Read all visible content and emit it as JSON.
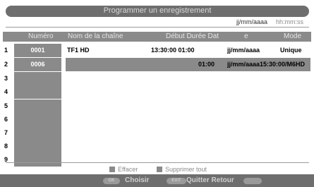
{
  "title": "Programmer un enregistrement",
  "hints": {
    "date_format": "jj/mm/aaaa",
    "time_format": "hh:mm:ss"
  },
  "table": {
    "headers": {
      "numero": "Numéro",
      "chaine": "Nom de la chaîne",
      "debut": "Début Durée Dat",
      "e": "e",
      "mode": "Mode"
    },
    "row_indices": [
      "1",
      "2",
      "3",
      "4",
      "5",
      "6",
      "7",
      "8",
      "9"
    ],
    "rows": [
      {
        "numero": "0001",
        "chaine": "TF1 HD",
        "debut": "13:30:00 01:00",
        "date": "jj/mm/aaaa",
        "mode": "Unique"
      },
      {
        "numero": "0006",
        "chaine": "",
        "debut": "01:00",
        "date": "jj/mm/aaaa15:30:00/M6HD",
        "mode": ""
      }
    ]
  },
  "legend": {
    "effacer": "Effacer",
    "supprimer_tout": "Supprimer tout"
  },
  "bottom": {
    "ok_key": "OK",
    "choisir": "Choisir",
    "exit_key": "EXIT",
    "quitter": "Quitter Retour"
  },
  "colors": {
    "panel": "#8a8a8a",
    "title_bar": "#6e6e6e",
    "background": "#ffffff"
  }
}
